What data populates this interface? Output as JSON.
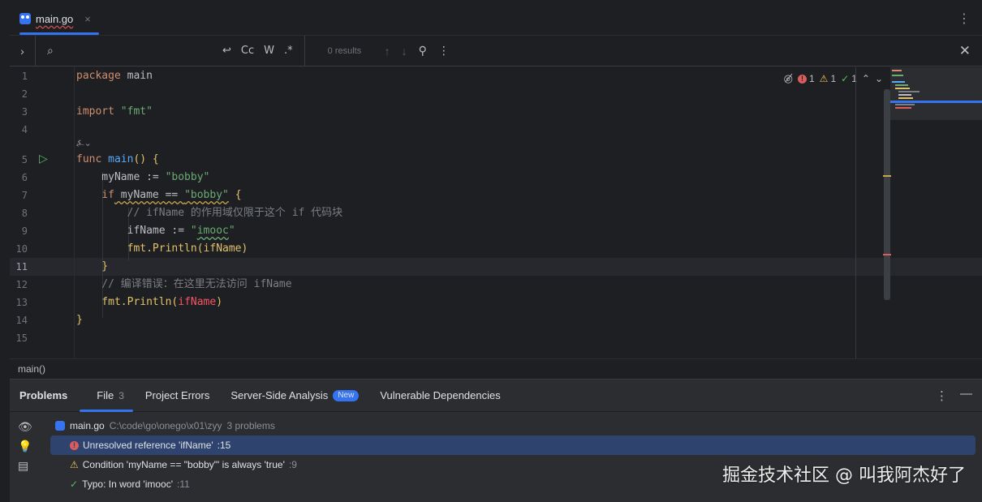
{
  "tab": {
    "filename": "main.go",
    "close": "×",
    "menu": "⋮"
  },
  "find": {
    "expand": "›",
    "search_icon": "⌕",
    "query": "",
    "opt_wrap": "↩",
    "opt_case": "Cc",
    "opt_word": "W",
    "opt_regex": ".*",
    "results": "0 results",
    "prev": "↑",
    "next": "↓",
    "filter": "⚲",
    "more": "⋮",
    "close": "✕"
  },
  "editor": {
    "line_numbers": [
      "1",
      "2",
      "3",
      "4",
      "5",
      "6",
      "7",
      "8",
      "9",
      "10",
      "11",
      "12",
      "13",
      "14",
      "15"
    ],
    "current_line": "11",
    "fold_marker": "⍼⌄",
    "inspections": {
      "errors": "1",
      "warnings": "1",
      "typos": "1"
    },
    "lines": {
      "l1_kw": "package",
      "l1_name": " main",
      "l3_kw": "import",
      "l3_str": " \"fmt\"",
      "l5_kw": "func",
      "l5_fn": " main",
      "l5_rest": "() {",
      "l6_id": "    myName := ",
      "l6_str": "\"bobby\"",
      "l7_kw": "    if",
      "l7_id": " myName",
      "l7_op": " == ",
      "l7_str": "\"bobby\"",
      "l7_brace": " {",
      "l8_cm": "        // ifName 的作用域仅限于这个 if 代码块",
      "l9_id": "        ifName := ",
      "l9_str_q1": "\"",
      "l9_str_word": "imooc",
      "l9_str_q2": "\"",
      "l10_pkg": "        fmt.",
      "l10_call": "Println",
      "l10_args": "(ifName)",
      "l11_brace": "    }",
      "l12_cm": "    // 编译错误：在这里无法访问 ifName",
      "l13_pkg": "    fmt.",
      "l13_call": "Println",
      "l13_p1": "(",
      "l13_err": "ifName",
      "l13_p2": ")",
      "l14_brace": "}"
    }
  },
  "breadcrumb": "main()",
  "problems": {
    "title": "Problems",
    "tabs": [
      {
        "label": "File",
        "count": "3"
      },
      {
        "label": "Project Errors"
      },
      {
        "label": "Server-Side Analysis",
        "badge": "New"
      },
      {
        "label": "Vulnerable Dependencies"
      }
    ],
    "menu": "⋮",
    "minimize": "—",
    "file": {
      "name": "main.go",
      "path": "C:\\code\\go\\onego\\x01\\zyy",
      "count": "3 problems"
    },
    "items": [
      {
        "text": "Unresolved reference 'ifName'",
        "loc": " :15",
        "severity": "error"
      },
      {
        "text": "Condition 'myName == \"bobby\"' is always 'true'",
        "loc": " :9",
        "severity": "warning"
      },
      {
        "text": "Typo: In word 'imooc'",
        "loc": " :11",
        "severity": "typo"
      }
    ]
  },
  "watermark": "掘金技术社区 @ 叫我阿杰好了",
  "colors": {
    "accent": "#3574f0",
    "error": "#db5c5c",
    "warning": "#f2c55c",
    "ok": "#5fb865"
  }
}
